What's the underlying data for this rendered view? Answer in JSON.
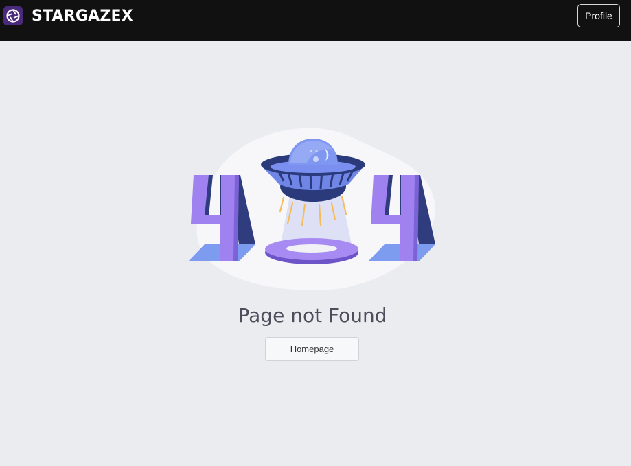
{
  "header": {
    "brand_name": "STARGAZEX",
    "logo_icon": "aperture-logo-icon",
    "profile_label": "Profile"
  },
  "main": {
    "illustration": "ufo-404-illustration",
    "title": "Page not Found",
    "homepage_label": "Homepage"
  },
  "colors": {
    "navbar": "#111111",
    "page_background": "#ebecf0",
    "digit_purple": "#9f82f0",
    "digit_dark": "#2f3d7e",
    "shadow_blue": "#7d9cf0",
    "ufo_dark": "#2b3a7a",
    "beam_yellow": "#f5bd5a"
  }
}
